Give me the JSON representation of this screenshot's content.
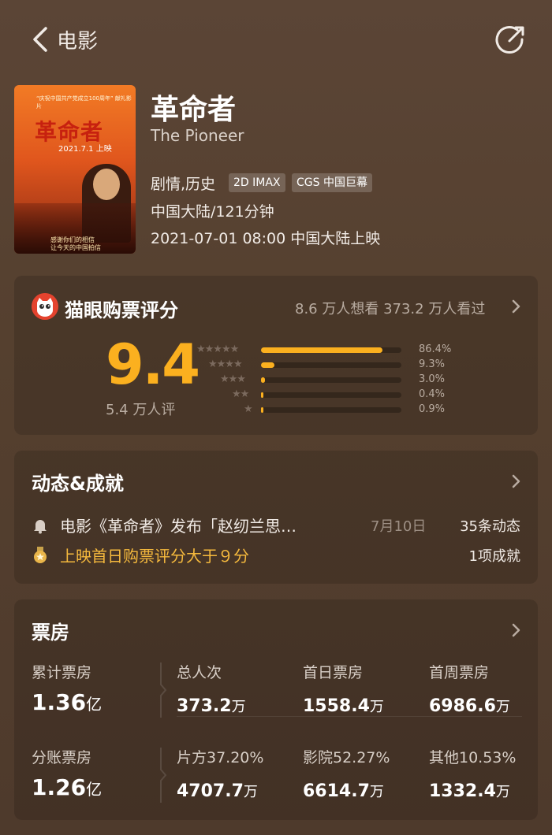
{
  "nav": {
    "title": "电影"
  },
  "movie": {
    "title": "革命者",
    "english_title": "The Pioneer",
    "genre": "剧情,历史",
    "tags": [
      "2D IMAX",
      "CGS 中国巨幕"
    ],
    "region_duration": "中国大陆/121分钟",
    "release": "2021-07-01 08:00 中国大陆上映",
    "poster": {
      "title": "革命者",
      "date": "2021.7.1 上映",
      "top_text": "“庆祝中国共产党成立100周年” 献礼影片",
      "slogan_1": "感谢你们的相信",
      "slogan_2": "让今天的中国拍信"
    }
  },
  "rating": {
    "title": "猫眼购票评分",
    "stats": "8.6 万人想看  373.2 万人看过",
    "score": "9.4",
    "count": "5.4 万人评",
    "distribution": [
      {
        "stars": 5,
        "percent": 86.4,
        "label": "86.4%"
      },
      {
        "stars": 4,
        "percent": 9.3,
        "label": "9.3%"
      },
      {
        "stars": 3,
        "percent": 3.0,
        "label": "3.0%"
      },
      {
        "stars": 2,
        "percent": 0.4,
        "label": "0.4%"
      },
      {
        "stars": 1,
        "percent": 0.9,
        "label": "0.9%"
      }
    ]
  },
  "news": {
    "title": "动态&成就",
    "headline": "电影《革命者》发布「赵纫兰思…",
    "date": "7月10日",
    "count": "35条动态",
    "achievement": "上映首日购票评分大于９分",
    "achievement_count": "1项成就"
  },
  "box_office": {
    "title": "票房",
    "row1": {
      "main_label": "累计票房",
      "main_value": "1.36",
      "main_unit": "亿",
      "cols": [
        {
          "label": "总人次",
          "value": "373.2",
          "unit": "万"
        },
        {
          "label": "首日票房",
          "value": "1558.4",
          "unit": "万"
        },
        {
          "label": "首周票房",
          "value": "6986.6",
          "unit": "万"
        }
      ]
    },
    "row2": {
      "main_label": "分账票房",
      "main_value": "1.26",
      "main_unit": "亿",
      "cols": [
        {
          "label": "片方37.20%",
          "value": "4707.7",
          "unit": "万"
        },
        {
          "label": "影院52.27%",
          "value": "6614.7",
          "unit": "万"
        },
        {
          "label": "其他10.53%",
          "value": "1332.4",
          "unit": "万"
        }
      ]
    }
  },
  "colors": {
    "accent": "#fbb01f",
    "background": "#55402f",
    "achievement": "#f5b93d",
    "maoyan_red": "#e4432e"
  }
}
